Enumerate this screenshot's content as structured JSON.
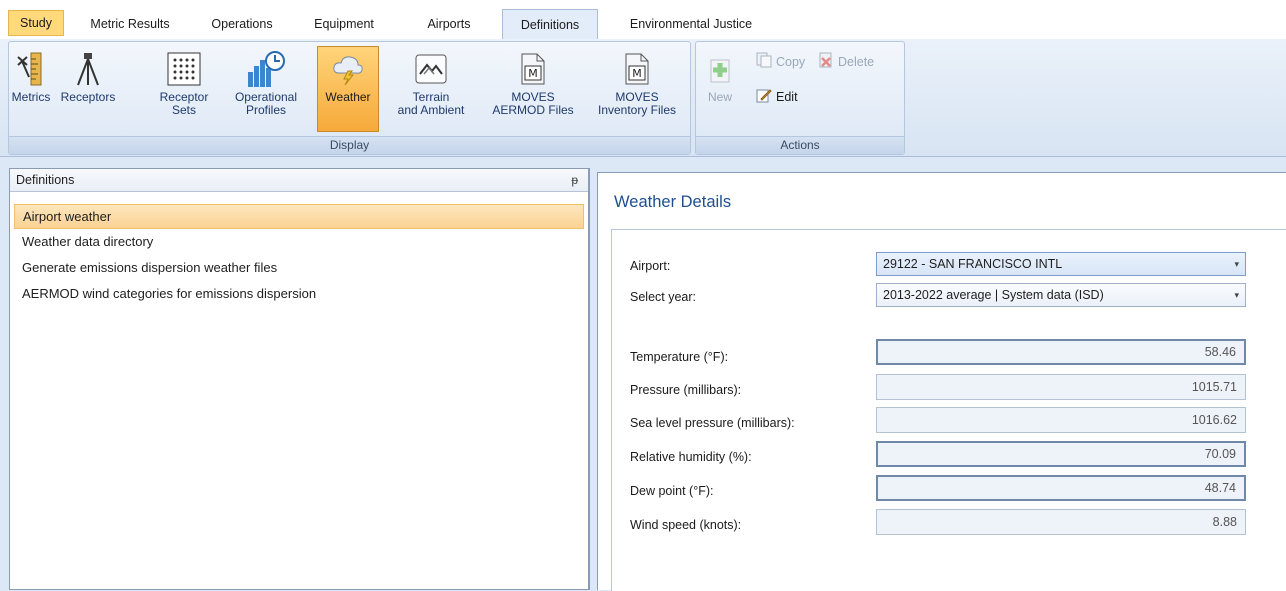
{
  "tabs": [
    {
      "label": "Study"
    },
    {
      "label": "Metric Results"
    },
    {
      "label": "Operations"
    },
    {
      "label": "Equipment"
    },
    {
      "label": "Airports"
    },
    {
      "label": "Definitions"
    },
    {
      "label": "Environmental Justice"
    }
  ],
  "ribbon": {
    "display_group": {
      "label": "Display",
      "buttons": [
        {
          "label": "Metrics",
          "icon": "ruler-icon"
        },
        {
          "label": "Receptors",
          "icon": "tripod-icon"
        },
        {
          "label": "Receptor\nSets",
          "icon": "dot-grid-icon"
        },
        {
          "label": "Operational\nProfiles",
          "icon": "bar-clock-icon"
        },
        {
          "label": "Weather",
          "icon": "storm-cloud-icon"
        },
        {
          "label": "Terrain\nand Ambient",
          "icon": "terrain-icon"
        },
        {
          "label": "MOVES\nAERMOD Files",
          "icon": "moves-file-icon"
        },
        {
          "label": "MOVES\nInventory Files",
          "icon": "moves-file-icon"
        }
      ]
    },
    "actions_group": {
      "label": "Actions",
      "new_label": "New",
      "copy_label": "Copy",
      "delete_label": "Delete",
      "edit_label": "Edit"
    }
  },
  "left_panel": {
    "title": "Definitions",
    "pin_glyph": "ᵽ",
    "items": [
      {
        "label": "Airport weather"
      },
      {
        "label": "Weather data directory"
      },
      {
        "label": "Generate emissions dispersion weather files"
      },
      {
        "label": "AERMOD wind categories for emissions dispersion"
      }
    ]
  },
  "weather": {
    "title": "Weather Details",
    "airport_label": "Airport:",
    "airport_value": "29122 - SAN FRANCISCO INTL",
    "year_label": "Select year:",
    "year_value": "2013-2022 average | System data (ISD)",
    "fields": [
      {
        "label": "Temperature (°F):",
        "value": "58.46"
      },
      {
        "label": "Pressure (millibars):",
        "value": "1015.71"
      },
      {
        "label": "Sea level pressure (millibars):",
        "value": "1016.62"
      },
      {
        "label": "Relative humidity (%):",
        "value": "70.09"
      },
      {
        "label": "Dew point (°F):",
        "value": "48.74"
      },
      {
        "label": "Wind speed (knots):",
        "value": "8.88"
      }
    ]
  },
  "colors": {
    "accent_orange": "#f6a93a",
    "title_blue": "#1f4f8f",
    "ribbon_bg": "#dfe9f6"
  }
}
